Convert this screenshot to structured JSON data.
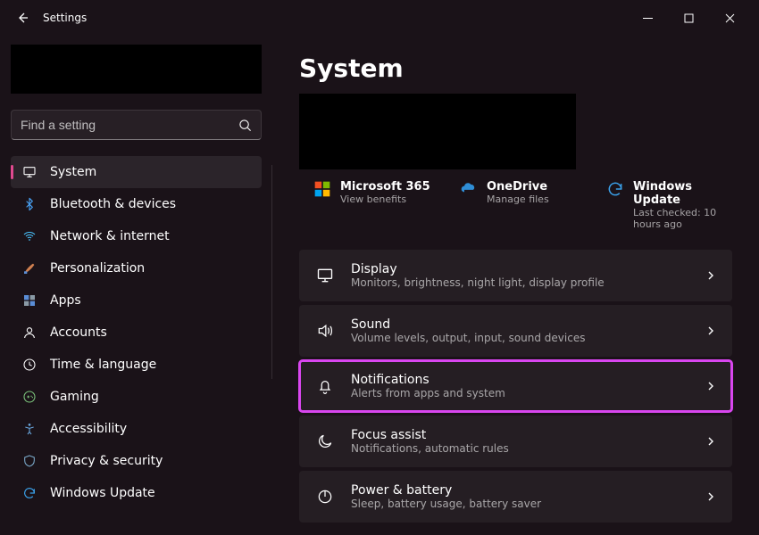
{
  "titlebar": {
    "title": "Settings"
  },
  "search": {
    "placeholder": "Find a setting"
  },
  "sidebar": {
    "items": [
      {
        "label": "System",
        "icon": "display",
        "active": true
      },
      {
        "label": "Bluetooth & devices",
        "icon": "bluetooth"
      },
      {
        "label": "Network & internet",
        "icon": "wifi"
      },
      {
        "label": "Personalization",
        "icon": "brush"
      },
      {
        "label": "Apps",
        "icon": "apps"
      },
      {
        "label": "Accounts",
        "icon": "account"
      },
      {
        "label": "Time & language",
        "icon": "clock"
      },
      {
        "label": "Gaming",
        "icon": "gaming"
      },
      {
        "label": "Accessibility",
        "icon": "accessibility"
      },
      {
        "label": "Privacy & security",
        "icon": "shield"
      },
      {
        "label": "Windows Update",
        "icon": "update"
      }
    ]
  },
  "main": {
    "heading": "System",
    "quick": [
      {
        "title": "Microsoft 365",
        "sub": "View benefits",
        "icon": "m365"
      },
      {
        "title": "OneDrive",
        "sub": "Manage files",
        "icon": "onedrive"
      },
      {
        "title": "Windows Update",
        "sub": "Last checked: 10 hours ago",
        "icon": "update"
      }
    ],
    "tiles": [
      {
        "title": "Display",
        "sub": "Monitors, brightness, night light, display profile",
        "icon": "display",
        "highlight": false
      },
      {
        "title": "Sound",
        "sub": "Volume levels, output, input, sound devices",
        "icon": "sound",
        "highlight": false
      },
      {
        "title": "Notifications",
        "sub": "Alerts from apps and system",
        "icon": "bell",
        "highlight": true
      },
      {
        "title": "Focus assist",
        "sub": "Notifications, automatic rules",
        "icon": "moon",
        "highlight": false
      },
      {
        "title": "Power & battery",
        "sub": "Sleep, battery usage, battery saver",
        "icon": "power",
        "highlight": false
      }
    ]
  },
  "colors": {
    "accent": "#e04a8f",
    "highlight": "#d946ef"
  }
}
